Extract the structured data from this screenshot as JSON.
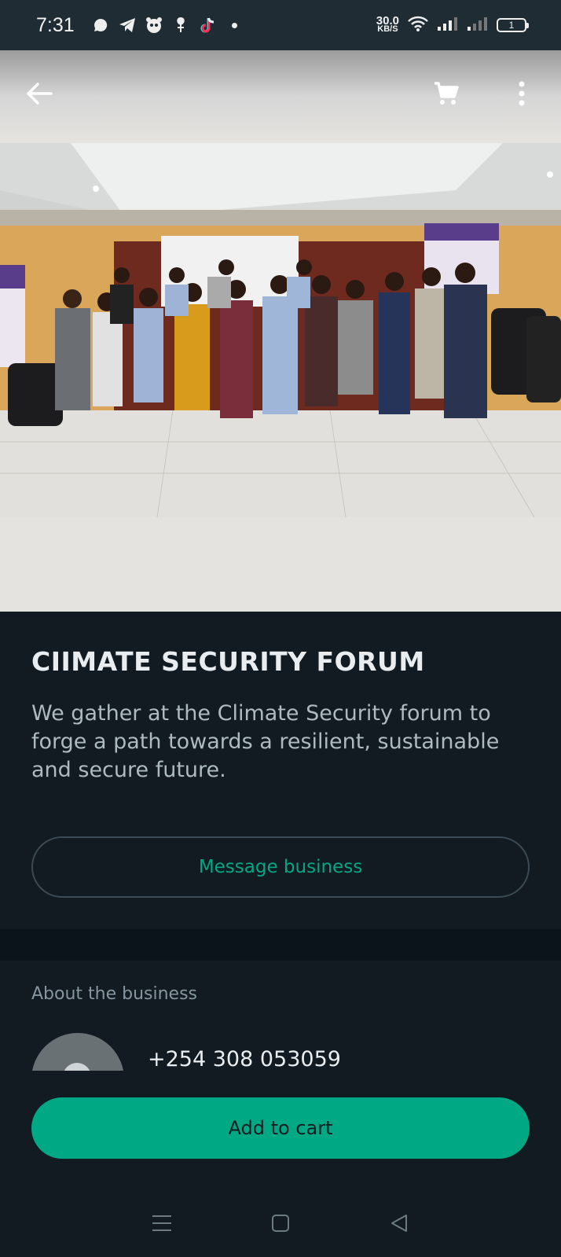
{
  "status_bar": {
    "time": "7:31",
    "net_speed_value": "30.0",
    "net_speed_unit": "KB/S",
    "battery_level": "1",
    "left_icons": [
      "whatsapp-icon",
      "telegram-icon",
      "panda-icon",
      "notification-icon",
      "tiktok-icon"
    ],
    "right_icons": [
      "wifi-icon",
      "signal-icon",
      "signal-icon-2",
      "battery-icon"
    ]
  },
  "top_bar": {
    "icons": [
      "back-arrow-icon",
      "cart-icon",
      "more-vert-icon"
    ]
  },
  "product": {
    "title": "CIIMATE SECURITY FORUM",
    "description": "We gather at the Climate Security forum to forge a path towards a resilient, sustainable and secure future.",
    "message_button": "Message business"
  },
  "about": {
    "title": "About the business",
    "phone": "+254 308 053059"
  },
  "cart": {
    "add_button": "Add to cart"
  },
  "colors": {
    "accent": "#00a884",
    "background": "#121b22",
    "status_bar": "#1f2c34"
  },
  "nav": {
    "icons": [
      "menu-icon",
      "home-square-icon",
      "back-triangle-icon"
    ]
  }
}
